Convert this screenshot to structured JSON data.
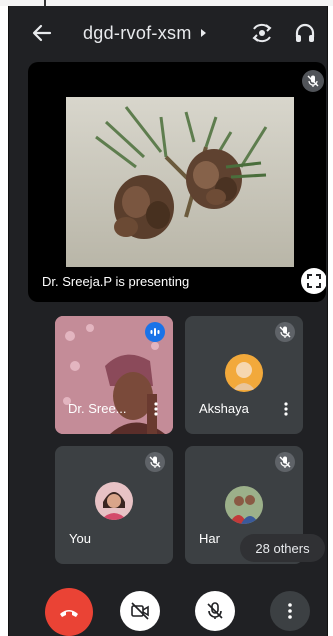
{
  "meeting": {
    "code": "dgd-rvof-xsm"
  },
  "presentation": {
    "label": "Dr. Sreeja.P is presenting"
  },
  "participants": [
    {
      "name": "Dr. Sree..."
    },
    {
      "name": "Akshaya"
    },
    {
      "name": "You"
    },
    {
      "name": "Har"
    }
  ],
  "others": {
    "label": "28 others"
  },
  "colors": {
    "background": "#202124",
    "tile": "#3c4043",
    "hangup": "#ea4335",
    "speaking": "#1a73e8"
  },
  "icons": [
    "back-arrow-icon",
    "chevron-right-icon",
    "switch-camera-icon",
    "headphones-icon",
    "mic-off-icon",
    "fullscreen-icon",
    "speaking-indicator-icon",
    "more-vert-icon",
    "hang-up-icon",
    "camera-off-icon"
  ]
}
